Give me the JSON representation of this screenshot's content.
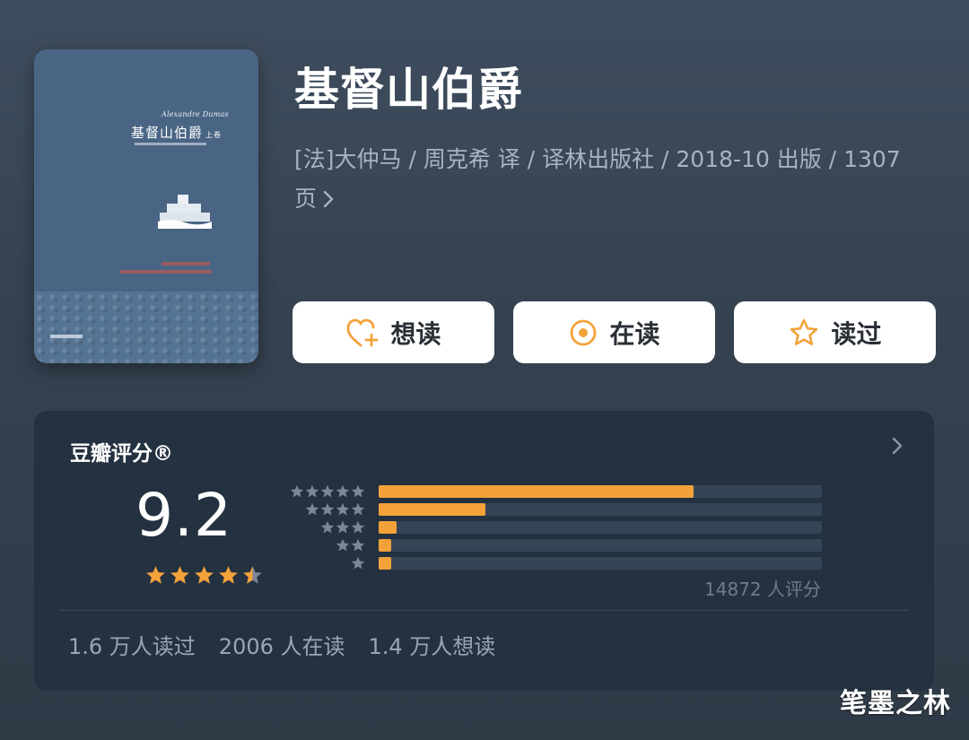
{
  "book": {
    "title": "基督山伯爵",
    "meta": "[法]大仲马 / 周克希 译 / 译林出版社 / 2018-10 出版 / 1307 页",
    "cover": {
      "author": "Alexandre Dumas",
      "title": "基督山伯爵",
      "volume": "上卷"
    }
  },
  "actions": [
    {
      "label": "想读",
      "icon": "heart-plus-icon"
    },
    {
      "label": "在读",
      "icon": "reading-circle-icon"
    },
    {
      "label": "读过",
      "icon": "star-outline-icon"
    }
  ],
  "rating": {
    "label": "豆瓣评分®",
    "score": "9.2",
    "score_stars": 4.5,
    "distribution": [
      {
        "stars": 5,
        "fraction": 0.71
      },
      {
        "stars": 4,
        "fraction": 0.24
      },
      {
        "stars": 3,
        "fraction": 0.04
      },
      {
        "stars": 2,
        "fraction": 0.01
      },
      {
        "stars": 1,
        "fraction": 0.01
      }
    ],
    "rater_count": "14872 人评分"
  },
  "stats": {
    "read": "1.6 万人读过",
    "reading": "2006 人在读",
    "want": "1.4 万人想读"
  },
  "watermark": "笔墨之林",
  "colors": {
    "accent": "#f3a23a",
    "card": "#243140",
    "bar_track": "#364556"
  }
}
